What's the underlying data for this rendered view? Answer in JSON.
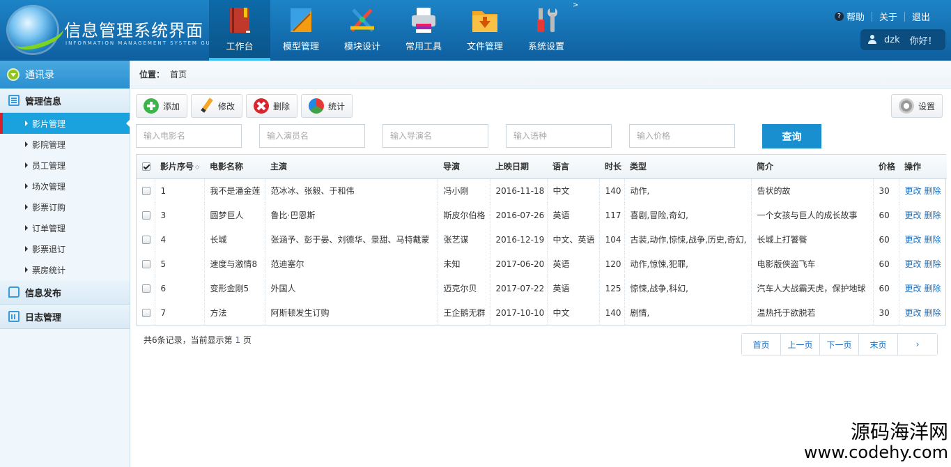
{
  "header": {
    "logo_title": "信息管理系统界面",
    "logo_subtitle": "INFORMATION MANAGEMENT SYSTEM GUI",
    "nav": [
      {
        "label": "工作台",
        "icon": "book-icon",
        "active": true
      },
      {
        "label": "模型管理",
        "icon": "ruler-icon",
        "active": false
      },
      {
        "label": "模块设计",
        "icon": "design-tools-icon",
        "active": false
      },
      {
        "label": "常用工具",
        "icon": "printer-icon",
        "active": false
      },
      {
        "label": "文件管理",
        "icon": "folder-icon",
        "active": false
      },
      {
        "label": "系统设置",
        "icon": "wrench-icon",
        "active": false
      }
    ],
    "nav_more": ">",
    "links": {
      "help": "帮助",
      "about": "关于",
      "logout": "退出"
    },
    "user": {
      "name": "dzk",
      "greeting": "你好！"
    }
  },
  "sidebar": {
    "header": "通讯录",
    "groups": [
      {
        "label": "管理信息",
        "icon": "list-icon",
        "items": [
          "影片管理",
          "影院管理",
          "员工管理",
          "场次管理",
          "影票订购",
          "订单管理",
          "影票退订",
          "票房统计"
        ],
        "active_item": 0
      },
      {
        "label": "信息发布",
        "icon": "chat-icon"
      },
      {
        "label": "日志管理",
        "icon": "calendar-icon"
      }
    ]
  },
  "breadcrumb": {
    "label": "位置：",
    "current": "首页"
  },
  "toolbar": {
    "add": "添加",
    "edit": "修改",
    "delete": "删除",
    "stats": "统计",
    "settings": "设置"
  },
  "filters": {
    "movie_name": "输入电影名",
    "actor": "输入演员名",
    "director": "输入导演名",
    "language": "输入语种",
    "price": "输入价格",
    "search_button": "查询"
  },
  "table": {
    "columns": [
      "影片序号",
      "电影名称",
      "主演",
      "导演",
      "上映日期",
      "语言",
      "时长",
      "类型",
      "简介",
      "价格",
      "操作"
    ],
    "rows": [
      {
        "id": "1",
        "name": "我不是潘金莲",
        "cast": "范冰冰、张毅、于和伟",
        "director": "冯小刚",
        "date": "2016-11-18",
        "lang": "中文",
        "duration": "140",
        "genre": "动作,",
        "intro": "告状的故",
        "price": "30"
      },
      {
        "id": "3",
        "name": "圆梦巨人",
        "cast": "鲁比·巴恩斯",
        "director": "斯皮尔伯格",
        "date": "2016-07-26",
        "lang": "英语",
        "duration": "117",
        "genre": "喜剧,冒险,奇幻,",
        "intro": "一个女孩与巨人的成长故事",
        "price": "60"
      },
      {
        "id": "4",
        "name": "长城",
        "cast": "张涵予、彭于晏、刘德华、景甜、马特戴蒙",
        "director": "张艺谋",
        "date": "2016-12-19",
        "lang": "中文、英语",
        "duration": "104",
        "genre": "古装,动作,惊悚,战争,历史,奇幻,",
        "intro": "长城上打饕餮",
        "price": "60"
      },
      {
        "id": "5",
        "name": "速度与激情8",
        "cast": "范迪塞尔",
        "director": "未知",
        "date": "2017-06-20",
        "lang": "英语",
        "duration": "120",
        "genre": "动作,惊悚,犯罪,",
        "intro": "电影版侠盗飞车",
        "price": "60"
      },
      {
        "id": "6",
        "name": "变形金刚5",
        "cast": "外国人",
        "director": "迈克尔贝",
        "date": "2017-07-22",
        "lang": "英语",
        "duration": "125",
        "genre": "惊悚,战争,科幻,",
        "intro": "汽车人大战霸天虎，保护地球",
        "price": "60"
      },
      {
        "id": "7",
        "name": "方法",
        "cast": "阿斯顿发生订购",
        "director": "王企鹅无群",
        "date": "2017-10-10",
        "lang": "中文",
        "duration": "140",
        "genre": "剧情,",
        "intro": "温热托于欲脱若",
        "price": "30"
      }
    ],
    "action_edit": "更改",
    "action_delete": "删除"
  },
  "footer": {
    "prefix": "共6条记录，当前显示第",
    "page": "1",
    "suffix": "页"
  },
  "pager": {
    "first": "首页",
    "prev": "上一页",
    "next": "下一页",
    "last": "末页",
    "forward": "›"
  },
  "watermark": {
    "line1": "源码海洋网",
    "line2": "www.codehy.com"
  },
  "colors": {
    "header": "#1279bd",
    "sidebar_active": "#1aa2de",
    "accent_red": "#d6212a",
    "search_button": "#1a8fd0",
    "link": "#1c6fbf"
  }
}
